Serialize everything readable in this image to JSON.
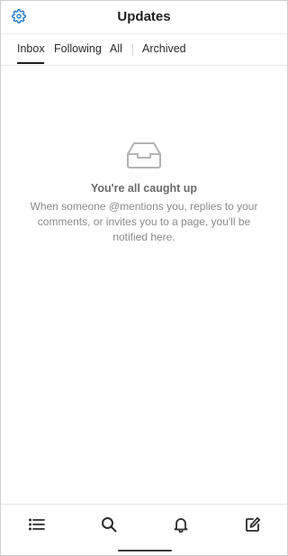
{
  "header": {
    "title": "Updates",
    "settings_icon": "gear-icon"
  },
  "tabs": [
    {
      "label": "Inbox",
      "active": true
    },
    {
      "label": "Following",
      "active": false
    },
    {
      "label": "All",
      "active": false
    },
    {
      "label": "Archived",
      "active": false
    }
  ],
  "empty_state": {
    "icon": "inbox-tray-icon",
    "title": "You're all caught up",
    "description": "When someone @mentions you, replies to your comments, or invites you to a page, you'll be notified here."
  },
  "bottom_nav": [
    {
      "icon": "list-icon"
    },
    {
      "icon": "search-icon"
    },
    {
      "icon": "bell-icon"
    },
    {
      "icon": "compose-icon"
    }
  ],
  "colors": {
    "accent": "#1a73c9",
    "icon": "#2a2a2a",
    "muted_text": "#8a8a8a"
  }
}
